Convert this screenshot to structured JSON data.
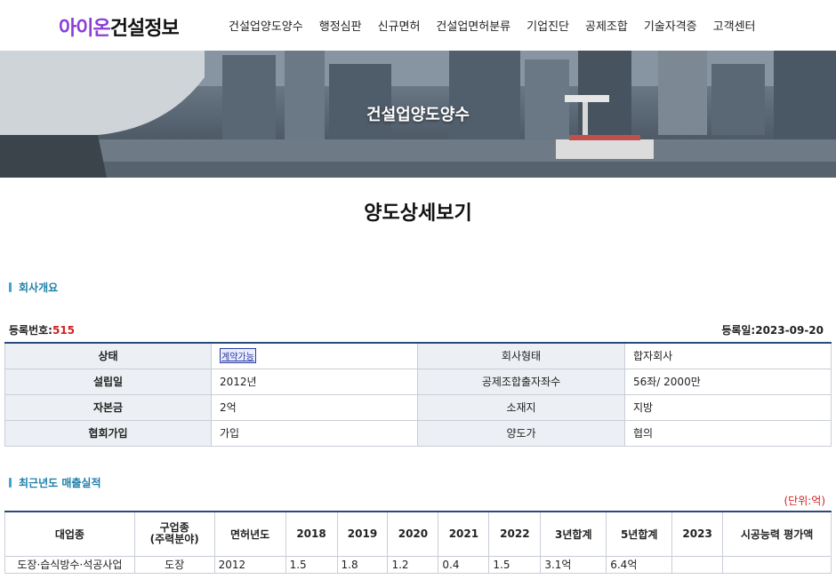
{
  "header": {
    "logo_brand": "아이온",
    "logo_rest": "건설정보",
    "nav": [
      "건설업양도양수",
      "행정심판",
      "신규면허",
      "건설업면허분류",
      "기업진단",
      "공제조합",
      "기술자격증",
      "고객센터"
    ]
  },
  "banner": {
    "title": "건설업양도양수"
  },
  "page_title": "양도상세보기",
  "company": {
    "section_title": "회사개요",
    "reg_no_label": "등록번호:",
    "reg_no": "515",
    "reg_date_label": "등록일:",
    "reg_date": "2023-09-20",
    "rows": [
      {
        "l1": "상태",
        "v1": "계약가능",
        "l2": "회사형태",
        "v2": "합자회사"
      },
      {
        "l1": "설립일",
        "v1": "2012년",
        "l2": "공제조합출자좌수",
        "v2": "56좌/ 2000만"
      },
      {
        "l1": "자본금",
        "v1": "2억",
        "l2": "소재지",
        "v2": "지방"
      },
      {
        "l1": "협회가입",
        "v1": "가입",
        "l2": "양도가",
        "v2": "협의"
      }
    ]
  },
  "sales": {
    "section_title": "최근년도 매출실적",
    "unit": "(단위:억)",
    "headers": [
      "대업종",
      "구업종\n(주력분야)",
      "면허년도",
      "2018",
      "2019",
      "2020",
      "2021",
      "2022",
      "3년합계",
      "5년합계",
      "2023",
      "시공능력 평가액"
    ],
    "rows": [
      [
        "도장·습식방수·석공사업",
        "도장",
        "2012",
        "1.5",
        "1.8",
        "1.2",
        "0.4",
        "1.5",
        "3.1억",
        "6.4억",
        "",
        ""
      ]
    ]
  },
  "colors": {
    "brand": "#8a3fd6",
    "accent": "#1f7fa8",
    "table_border": "#2a4a7a",
    "highlight": "#d21f1f"
  }
}
